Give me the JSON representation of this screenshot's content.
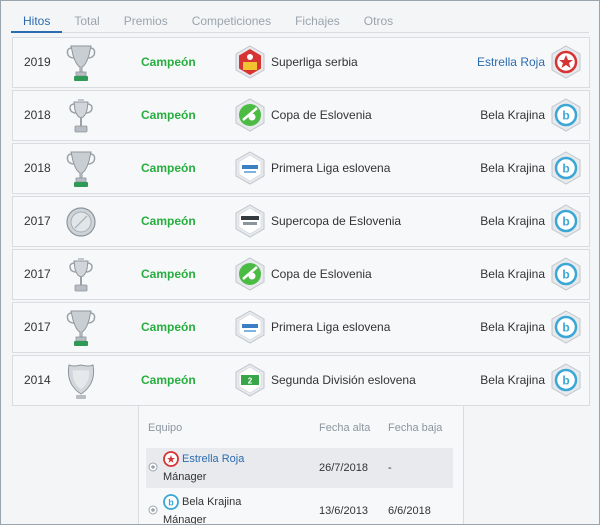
{
  "tabs": [
    "Hitos",
    "Total",
    "Premios",
    "Competiciones",
    "Fichajes",
    "Otros"
  ],
  "rows": [
    {
      "year": "2019",
      "result": "Campeón",
      "competition": "Superliga serbia",
      "team": "Estrella Roja"
    },
    {
      "year": "2018",
      "result": "Campeón",
      "competition": "Copa de Eslovenia",
      "team": "Bela Krajina"
    },
    {
      "year": "2018",
      "result": "Campeón",
      "competition": "Primera Liga eslovena",
      "team": "Bela Krajina"
    },
    {
      "year": "2017",
      "result": "Campeón",
      "competition": "Supercopa de Eslovenia",
      "team": "Bela Krajina"
    },
    {
      "year": "2017",
      "result": "Campeón",
      "competition": "Copa de Eslovenia",
      "team": "Bela Krajina"
    },
    {
      "year": "2017",
      "result": "Campeón",
      "competition": "Primera Liga eslovena",
      "team": "Bela Krajina"
    },
    {
      "year": "2014",
      "result": "Campeón",
      "competition": "Segunda División eslovena",
      "team": "Bela Krajina"
    }
  ],
  "career": {
    "headers": {
      "team": "Equipo",
      "start": "Fecha alta",
      "end": "Fecha baja"
    },
    "rows": [
      {
        "team": "Estrella Roja",
        "role": "Mánager",
        "start": "26/7/2018",
        "end": "-"
      },
      {
        "team": "Bela Krajina",
        "role": "Mánager",
        "start": "13/6/2013",
        "end": "6/6/2018"
      }
    ]
  }
}
